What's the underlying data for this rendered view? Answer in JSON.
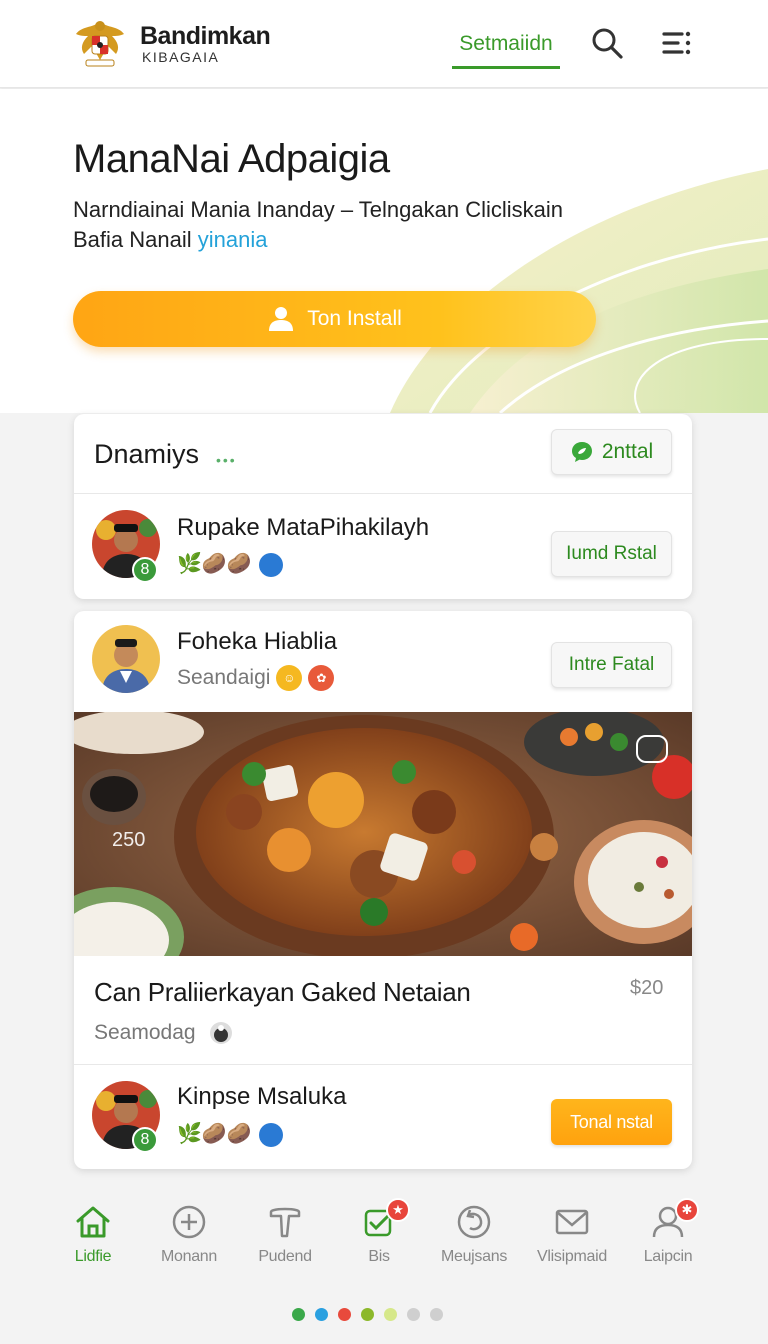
{
  "header": {
    "brand_name": "Bandimkan",
    "brand_sub": "KIBAGAIA",
    "nav_link": "Setmaiidn"
  },
  "hero": {
    "title": "ManaNai Adpaigia",
    "subtitle_line1": "Narndiainai Mania Inanday – Telngakan Clicliskain",
    "subtitle_line2": "Bafia Nanail",
    "subtitle_link": "yinania",
    "install_button": "Ton Install"
  },
  "card1": {
    "title": "Dnamiys",
    "dots": "•••",
    "head_button": "2nttal",
    "row": {
      "name": "Rupake MataPihakilayh",
      "badge": "8",
      "emojis": "🌿🥔🥔",
      "button": "Iumd Rstal"
    }
  },
  "card2": {
    "author": {
      "name": "Foheka Hiablia",
      "meta": "Seandaigi",
      "button": "Intre Fatal"
    },
    "image_count": "250",
    "post_title": "Can Praliierkayan Gaked Netaian",
    "price": "$20",
    "seller": "Seamodag",
    "row": {
      "name": "Kinpse Msaluka",
      "badge": "8",
      "emojis": "🌿🥔🥔",
      "button": "Tonal nstal"
    }
  },
  "bottom_nav": [
    {
      "label": "Lidfie",
      "icon": "home-icon",
      "active": true
    },
    {
      "label": "Monann",
      "icon": "plus-circle-icon",
      "active": false
    },
    {
      "label": "Pudend",
      "icon": "tag-icon",
      "active": false
    },
    {
      "label": "Bis",
      "icon": "checkbox-icon",
      "active": false
    },
    {
      "label": "Meujsans",
      "icon": "refresh-icon",
      "active": false
    },
    {
      "label": "Vlisipmaid",
      "icon": "mail-icon",
      "active": false
    },
    {
      "label": "Laipcin",
      "icon": "profile-icon",
      "active": false
    }
  ],
  "pager_colors": [
    "#3aa84a",
    "#2aa0e0",
    "#e84a3c",
    "#8cb82a",
    "#d6e88a",
    "#cfcfcf",
    "#cfcfcf"
  ],
  "colors": {
    "accent_green": "#3a9a2a",
    "accent_orange": "#ffa514",
    "link_blue": "#24a2d9"
  }
}
